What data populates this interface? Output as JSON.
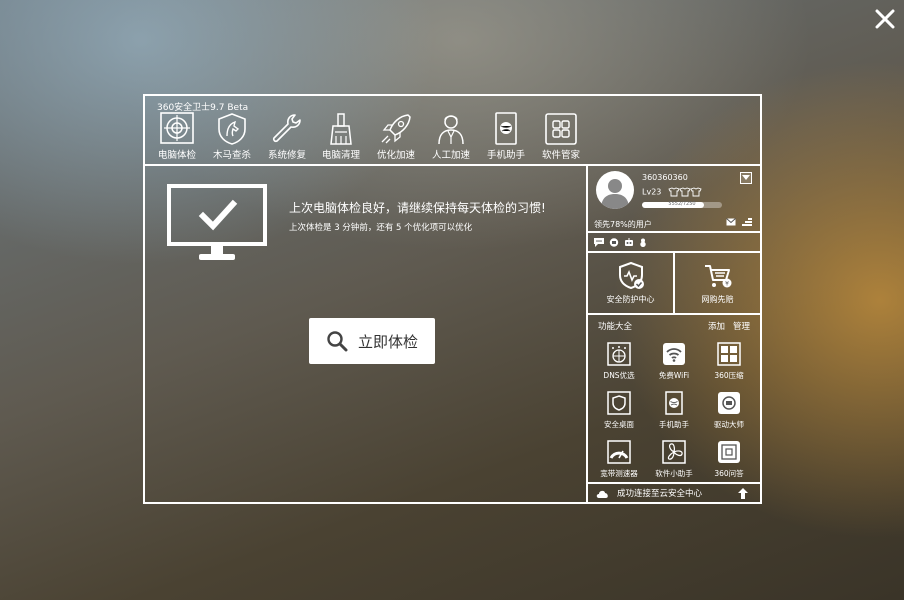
{
  "app": {
    "version": "360安全卫士9.7 Beta"
  },
  "toolbar": {
    "items": [
      {
        "label": "电脑体检",
        "icon": "target-icon"
      },
      {
        "label": "木马查杀",
        "icon": "shield-horse-icon"
      },
      {
        "label": "系统修复",
        "icon": "wrench-icon"
      },
      {
        "label": "电脑清理",
        "icon": "broom-icon"
      },
      {
        "label": "优化加速",
        "icon": "rocket-icon"
      },
      {
        "label": "人工加速",
        "icon": "person-icon"
      },
      {
        "label": "手机助手",
        "icon": "phone-icon"
      },
      {
        "label": "软件管家",
        "icon": "apps-grid-icon"
      }
    ]
  },
  "main": {
    "status_title": "上次电脑体检良好，请继续保持每天体检的习惯!",
    "status_sub": "上次体检是 3 分钟前，还有 5 个优化项可以优化",
    "check_button": "立即体检"
  },
  "profile": {
    "username": "360360360",
    "level": "Lv23",
    "xp_text": "5552/7250",
    "xp_fraction": 0.77,
    "rank": "领先78%的用户"
  },
  "tiles": [
    {
      "label": "安全防护中心",
      "icon": "shield-check-icon"
    },
    {
      "label": "网购先赔",
      "icon": "cart-icon"
    }
  ],
  "functions": {
    "title": "功能大全",
    "add": "添加",
    "manage": "管理",
    "items": [
      {
        "label": "DNS优选",
        "icon": "dns-icon"
      },
      {
        "label": "免费WiFi",
        "icon": "wifi-icon"
      },
      {
        "label": "360压缩",
        "icon": "compress-icon"
      },
      {
        "label": "安全桌面",
        "icon": "desktop-shield-icon"
      },
      {
        "label": "手机助手",
        "icon": "phone-icon"
      },
      {
        "label": "驱动大师",
        "icon": "driver-icon"
      },
      {
        "label": "宽带测速器",
        "icon": "speedometer-icon"
      },
      {
        "label": "软件小助手",
        "icon": "fan-icon"
      },
      {
        "label": "360问答",
        "icon": "qa-icon"
      }
    ]
  },
  "footer": {
    "status": "成功连接至云安全中心"
  }
}
